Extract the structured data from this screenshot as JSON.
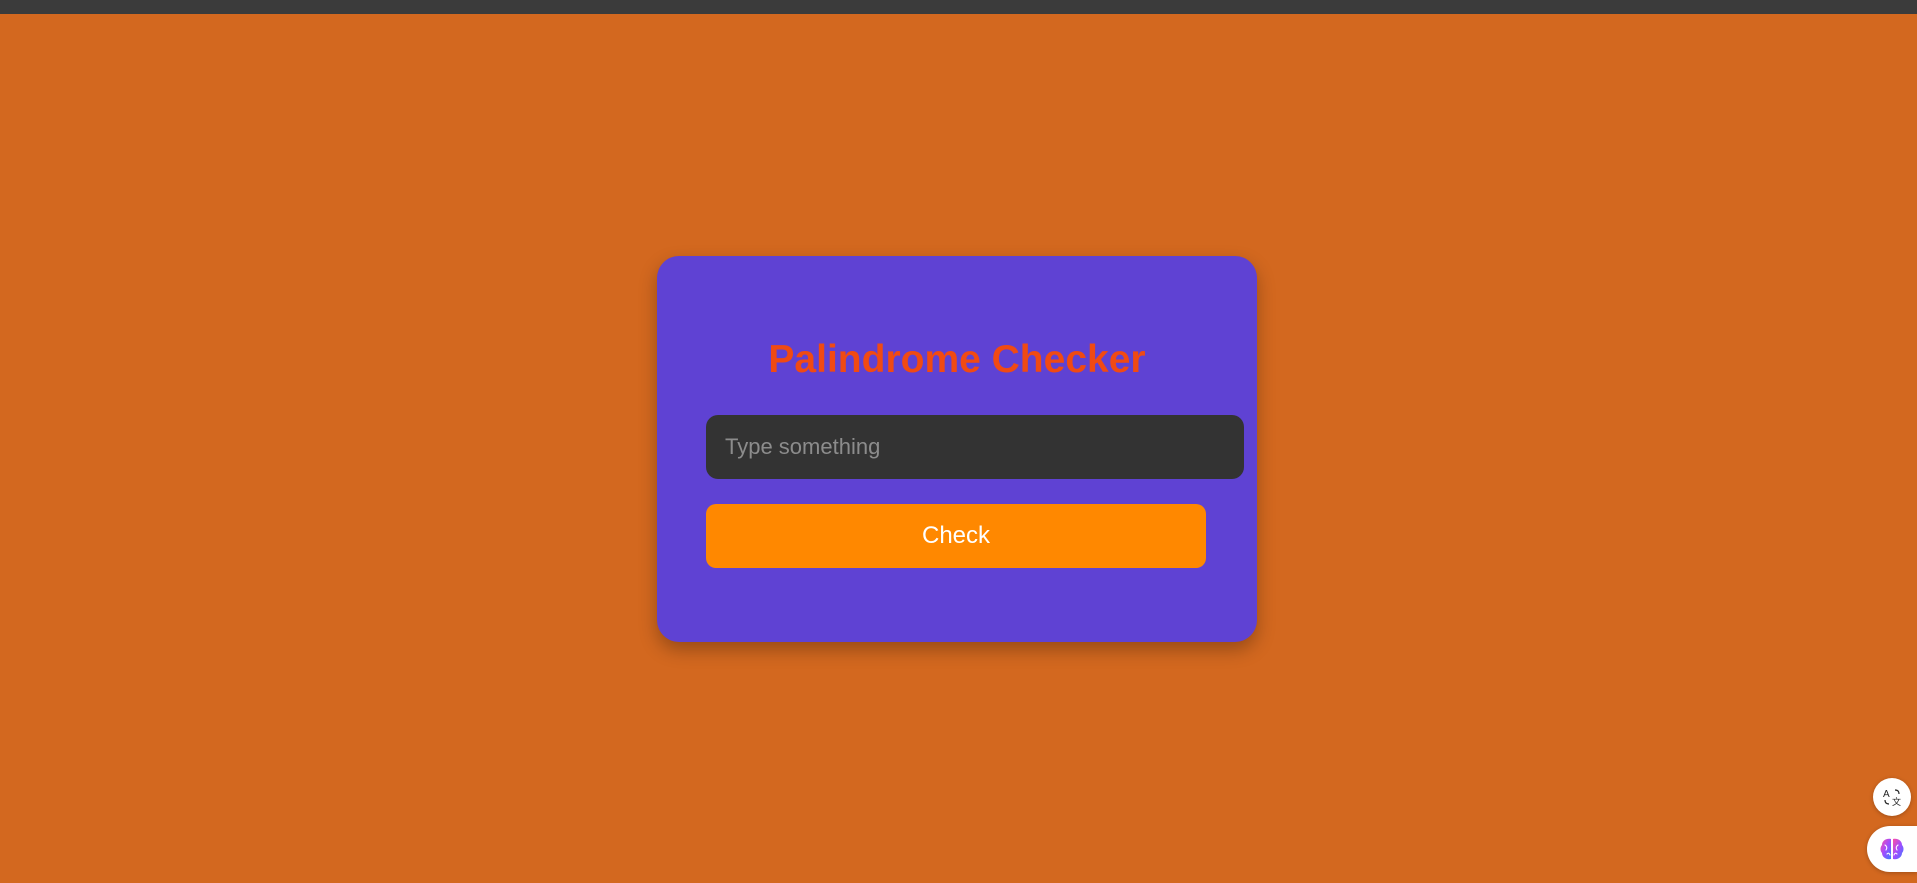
{
  "app": {
    "title": "Palindrome Checker"
  },
  "input": {
    "value": "",
    "placeholder": "Type something"
  },
  "button": {
    "label": "Check"
  },
  "floating_buttons": {
    "translate_icon": "translate-icon",
    "ai_assistant_icon": "brain-icon"
  },
  "colors": {
    "page_background": "#d3681f",
    "top_bar": "#3b3b3b",
    "card_background": "#5f42d3",
    "title_color": "#f04a13",
    "input_background": "#333333",
    "button_background": "#ff8800",
    "button_text": "#ffffff"
  }
}
